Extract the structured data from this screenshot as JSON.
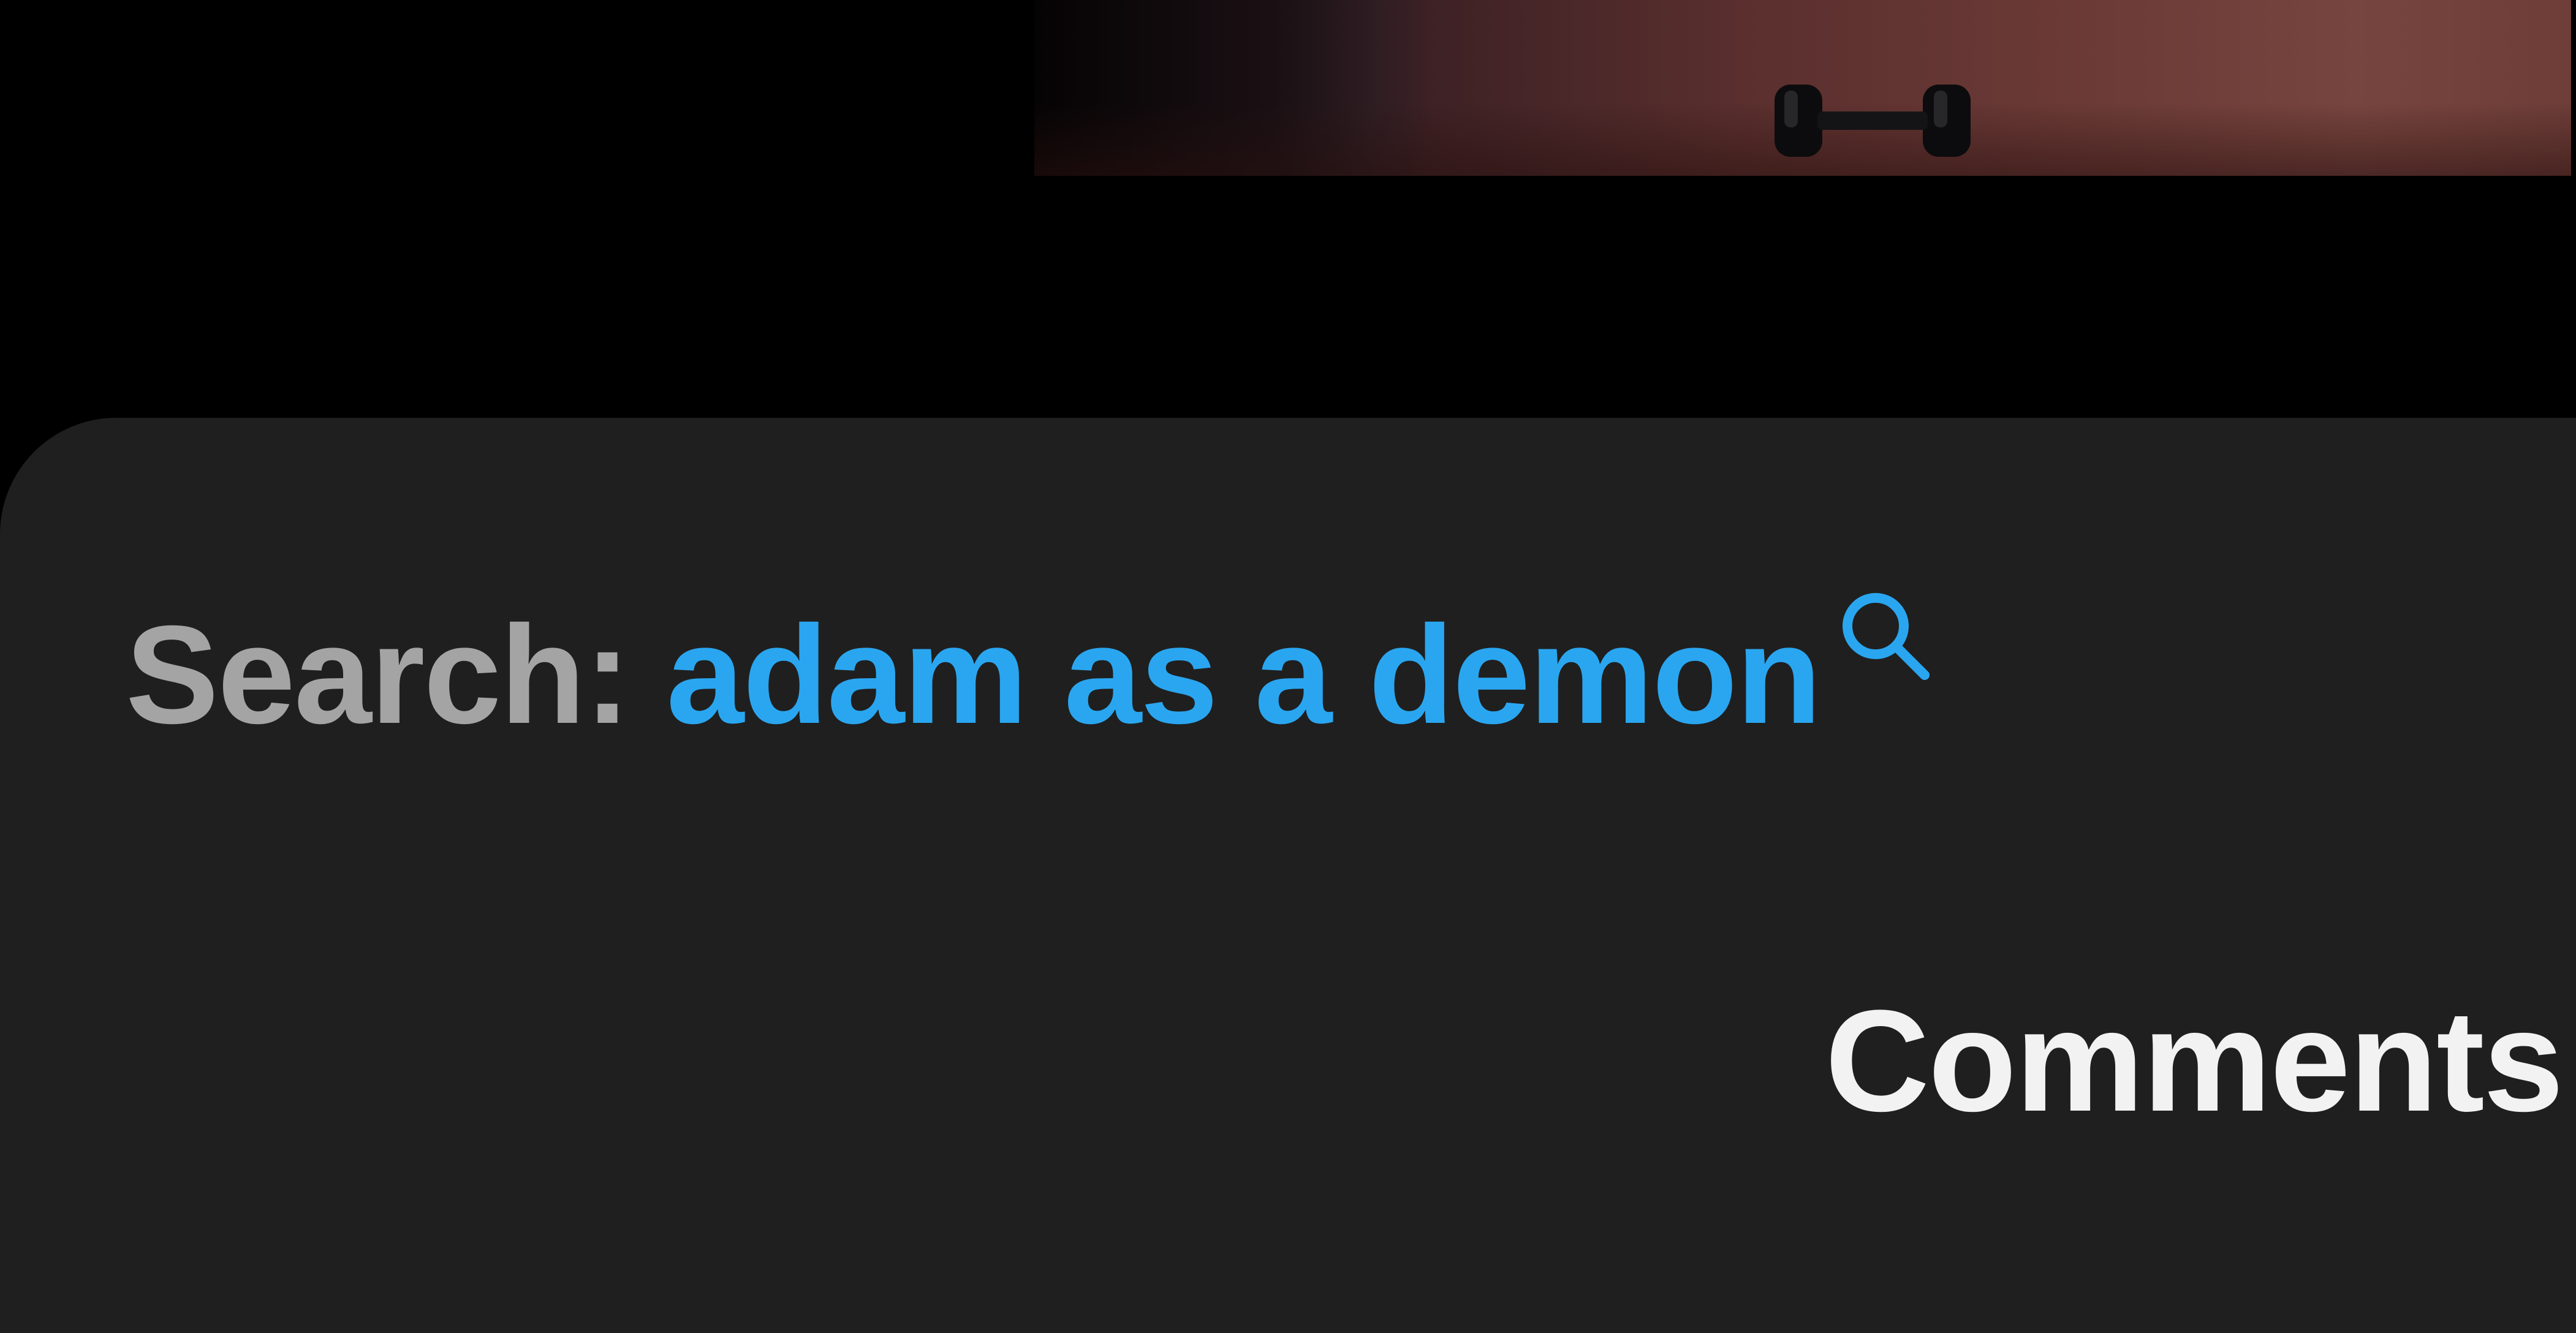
{
  "video": {
    "description_icon": "dumbbell-icon"
  },
  "comments_sheet": {
    "search": {
      "label": "Search:",
      "query": "adam as a demon",
      "icon": "search-icon",
      "label_color": "#a4a4a4",
      "query_color": "#2aa6f0"
    },
    "title": "Comments",
    "background_color": "#1f1f1f"
  }
}
